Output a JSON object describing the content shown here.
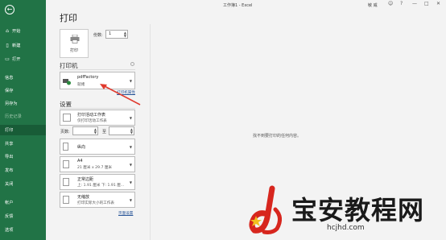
{
  "window": {
    "title": "工作簿1 - Excel",
    "user": "敏 威",
    "controls": [
      "?",
      "—",
      "□",
      "✕"
    ]
  },
  "sidebar": {
    "back_icon": "arrow-left-icon",
    "items": [
      {
        "label": "开始",
        "icon": "home-icon"
      },
      {
        "label": "新建",
        "icon": "new-file-icon"
      },
      {
        "label": "打开",
        "icon": "folder-open-icon"
      },
      {
        "label": "信息"
      },
      {
        "label": "保存"
      },
      {
        "label": "另存为"
      },
      {
        "label": "历史记录"
      },
      {
        "label": "打印",
        "active": true
      },
      {
        "label": "共享"
      },
      {
        "label": "导出"
      },
      {
        "label": "发布"
      },
      {
        "label": "关闭"
      },
      {
        "label": "帐户"
      },
      {
        "label": "反馈"
      },
      {
        "label": "选项"
      }
    ]
  },
  "main": {
    "title": "打印",
    "print_button": "打印",
    "copies_label": "份数:",
    "copies_value": "1",
    "printer_section": "打印机",
    "printer_name": "pdfFactory",
    "printer_status": "就绪",
    "printer_props_link": "打印机属性",
    "settings_section": "设置",
    "settings": [
      {
        "t1": "打印活动工作表",
        "t2": "仅打印活动工作表"
      },
      {
        "t1": "纵向",
        "t2": ""
      },
      {
        "t1": "A4",
        "t2": "21 厘米 x 29.7 厘米"
      },
      {
        "t1": "正常边距",
        "t2": "上: 1.91 厘米 下: 1.91 厘..."
      },
      {
        "t1": "无缩放",
        "t2": "打印实际大小的工作表"
      }
    ],
    "pages_label": "页数:",
    "pages_to": "至",
    "page_setup_link": "页面设置",
    "preview_message": "找不到要打印的任何内容。"
  },
  "watermark": {
    "text": "宝安教程网",
    "url": "hcjhd.com"
  },
  "colors": {
    "sidebar": "#217346",
    "sidebar_active": "#185c37",
    "arrow": "#e03a2e"
  }
}
